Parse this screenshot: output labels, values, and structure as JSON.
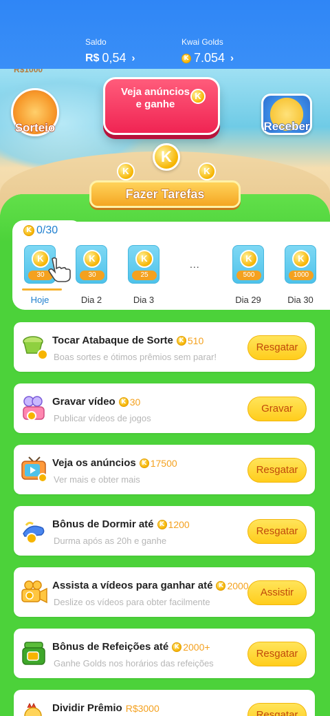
{
  "header": {
    "saldo": {
      "label": "Saldo",
      "currency": "R$",
      "value": "0,54",
      "chevron": "›"
    },
    "golds": {
      "label": "Kwai Golds",
      "value": "7.054",
      "chevron": "›"
    }
  },
  "hero": {
    "partial_tag": "R$1000",
    "sorteio_label": "Sorteio",
    "ad_label": "Veja anúncios e ganhe",
    "receber_label": "Receber",
    "coin_letter": "K",
    "tasks_banner": "Fazer Tarefas"
  },
  "checkin": {
    "counter": "0/30",
    "days": [
      {
        "label": "Hoje",
        "amount": "30"
      },
      {
        "label": "Dia 2",
        "amount": "30"
      },
      {
        "label": "Dia 3",
        "amount": "25"
      },
      {
        "label": "Dia 29",
        "amount": "500"
      },
      {
        "label": "Dia 30",
        "amount": "1000"
      }
    ],
    "ellipsis": "..."
  },
  "tasks": [
    {
      "title": "Tocar Atabaque de Sorte",
      "reward": "510",
      "subtitle": "Boas sortes e ótimos prêmios sem parar!",
      "button": "Resgatar",
      "icon": "drum-icon"
    },
    {
      "title": "Gravar vídeo",
      "reward": "30",
      "subtitle": "Publicar vídeos de jogos",
      "button": "Gravar",
      "icon": "camera-icon"
    },
    {
      "title": "Veja os anúncios",
      "reward": "17500",
      "subtitle": "Ver mais e obter mais",
      "button": "Resgatar",
      "icon": "tv-icon"
    },
    {
      "title": "Bônus de Dormir até",
      "reward": "1200",
      "subtitle": "Durma após as 20h e ganhe",
      "button": "Resgatar",
      "icon": "sleep-icon"
    },
    {
      "title": "Assista a vídeos para ganhar até",
      "reward": "2000",
      "subtitle": "Deslize os vídeos para obter facilmente",
      "button": "Assistir",
      "icon": "video-camera-icon"
    },
    {
      "title": "Bônus de Refeições até",
      "reward": "2000+",
      "subtitle": "Ganhe Golds nos horários das refeições",
      "button": "Resgatar",
      "icon": "lunchbox-icon"
    },
    {
      "title": "Dividir Prêmio",
      "reward": "R$3000",
      "subtitle": "",
      "button": "Resgatar",
      "icon": "chicken-icon"
    }
  ],
  "colors": {
    "header_blue": "#3a8ff7",
    "board_green": "#4cd23a",
    "coin_gold": "#f6b400",
    "button_yellow": "#ffd62e",
    "button_text": "#c0480b"
  }
}
